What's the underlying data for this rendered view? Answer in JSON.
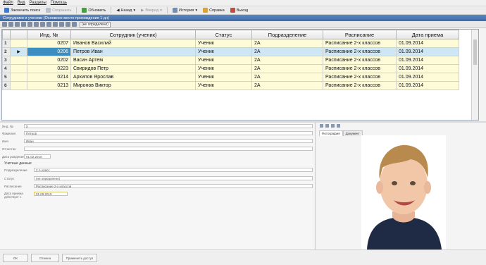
{
  "menu": [
    "Файл",
    "Вид",
    "Разделы",
    "Помощь"
  ],
  "toolbar": [
    {
      "label": "Закончить поиск",
      "enabled": true
    },
    {
      "label": "Сохранить",
      "enabled": false
    },
    {
      "label": "Обновить",
      "enabled": true
    },
    {
      "label": "Назад",
      "enabled": true
    },
    {
      "label": "Вперед",
      "enabled": false
    },
    {
      "label": "История",
      "enabled": true
    },
    {
      "label": "Справка",
      "enabled": true
    },
    {
      "label": "Выход",
      "enabled": true
    }
  ],
  "window_title": "Сотрудники и ученики (Основное место прохождения 1 дн)",
  "grid_toolbar": {
    "combo": "(не определено)"
  },
  "table": {
    "columns": [
      "Инд. №",
      "Сотрудник (ученик)",
      "Статус",
      "Подразделение",
      "Расписание",
      "Дата приема"
    ],
    "rows": [
      {
        "n": "1",
        "id": "0207",
        "name": "Иванов Василий",
        "status": "Ученик",
        "dept": "2А",
        "sched": "Расписание 2-х классов",
        "date": "01.09.2014"
      },
      {
        "n": "2",
        "id": "0206",
        "name": "Петров Иван",
        "status": "Ученик",
        "dept": "2А",
        "sched": "Расписание 2-х классов",
        "date": "01.09.2014"
      },
      {
        "n": "3",
        "id": "0202",
        "name": "Васин Артем",
        "status": "Ученик",
        "dept": "2А",
        "sched": "Расписание 2-х классов",
        "date": "01.09.2014"
      },
      {
        "n": "4",
        "id": "0223",
        "name": "Свиридов Петр",
        "status": "Ученик",
        "dept": "2А",
        "sched": "Расписание 2-х классов",
        "date": "01.09.2014"
      },
      {
        "n": "5",
        "id": "0214",
        "name": "Архипов Ярослав",
        "status": "Ученик",
        "dept": "2А",
        "sched": "Расписание 2-х классов",
        "date": "01.09.2014"
      },
      {
        "n": "6",
        "id": "0213",
        "name": "Миронов Виктор",
        "status": "Ученик",
        "dept": "2А",
        "sched": "Расписание 2-х классов",
        "date": "01.09.2014"
      }
    ]
  },
  "form": {
    "id_label": "Инд. №",
    "id_value": "0",
    "surname_label": "Фамилия",
    "surname_value": "Петров",
    "name_label": "Имя",
    "name_value": "Иван",
    "patronymic_label": "Отчество",
    "patronymic_value": "",
    "birth_label": "Дата рождения",
    "birth_value": "01.02.2010",
    "section": "Учетные данные",
    "dept_label": "Подразделение",
    "dept_value": "2 А класс",
    "status_label": "Статус",
    "status_value": "(не определено)",
    "sched_label": "Расписание",
    "sched_value": "Расписание 2-х классов",
    "hire_label": "Дата приема действует с",
    "hire_value": "01.09.2015"
  },
  "photo_tabs": [
    "Фотография",
    "Документ"
  ],
  "footer": [
    "OK",
    "Отмена",
    "Применить доступ"
  ]
}
